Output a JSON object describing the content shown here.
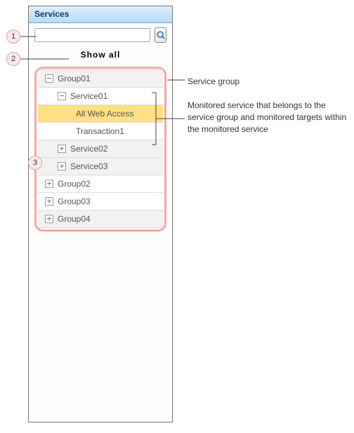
{
  "panel": {
    "title": "Services"
  },
  "search": {
    "value": "",
    "placeholder": ""
  },
  "show_all_label": "Show all",
  "tree": {
    "group01": "Group01",
    "service01": "Service01",
    "all_web": "All Web Access",
    "trans1": "Transaction1",
    "service02": "Service02",
    "service03": "Service03",
    "group02": "Group02",
    "group03": "Group03",
    "group04": "Group04"
  },
  "callouts": {
    "n1": "1",
    "n2": "2",
    "n3": "3",
    "a1": "Service group",
    "a2": "Monitored service that belongs to the service group and monitored targets within the monitored service"
  },
  "icons": {
    "minus": "−",
    "plus": "+"
  }
}
